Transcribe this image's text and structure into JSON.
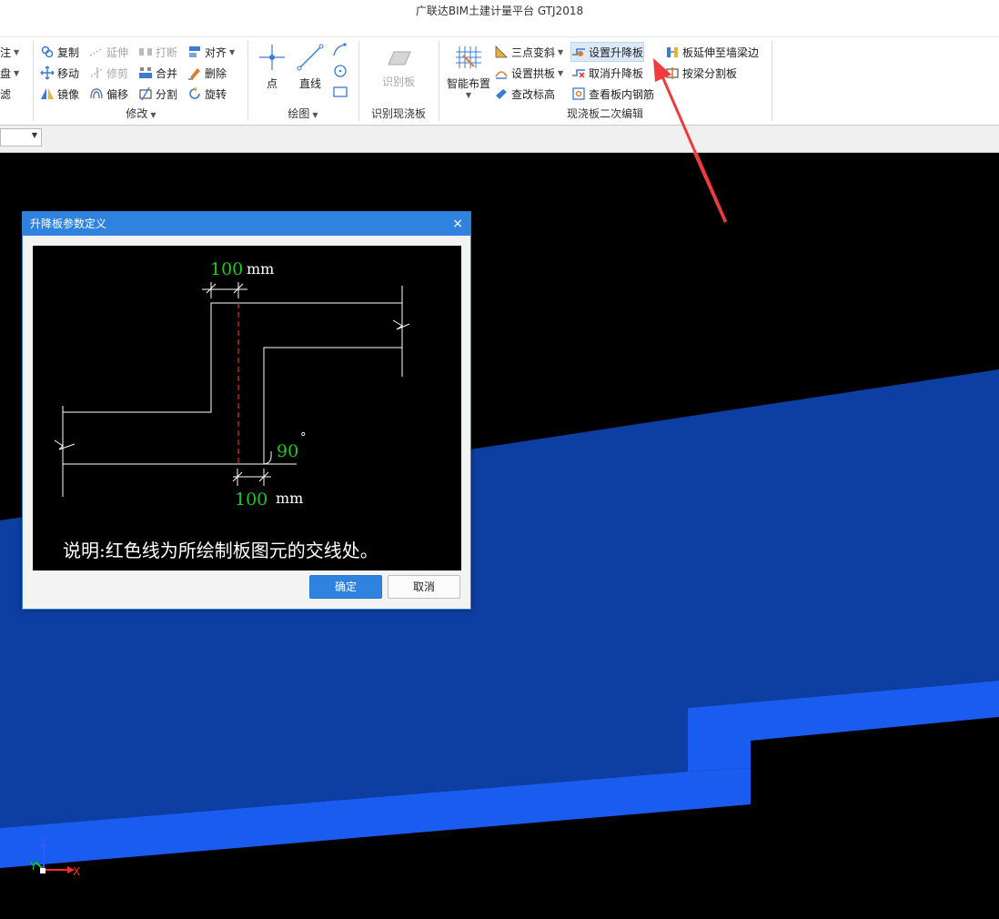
{
  "window": {
    "title": "广联达BIM土建计量平台 GTJ2018"
  },
  "ribbon": {
    "left_partial": [
      "注",
      "盘",
      "滤"
    ],
    "modify": {
      "label": "修改",
      "items": {
        "copy": "复制",
        "extend": "延伸",
        "break": "打断",
        "align": "对齐",
        "move": "移动",
        "trim": "修剪",
        "merge": "合并",
        "delete": "删除",
        "mirror": "镜像",
        "offset": "偏移",
        "split": "分割",
        "rotate": "旋转"
      }
    },
    "draw": {
      "label": "绘图",
      "point": "点",
      "line": "直线"
    },
    "recognize": {
      "label": "识别现浇板",
      "recognize_slab": "识别板"
    },
    "smart": {
      "label": "智能布置"
    },
    "slab_edit": {
      "label": "现浇板二次编辑",
      "three_point_slope": "三点变斜",
      "set_arch": "设置拱板",
      "check_elevation": "查改标高",
      "set_lift": "设置升降板",
      "cancel_lift": "取消升降板",
      "view_rebar": "查看板内钢筋",
      "extend_to_wall": "板延伸至墙梁边",
      "split_by_beam": "按梁分割板"
    }
  },
  "axes": {
    "z": "Z",
    "y": "Y",
    "x": "X"
  },
  "dialog": {
    "title": "升降板参数定义",
    "close": "×",
    "top_value": "100",
    "top_unit": "mm",
    "angle_value": "90",
    "angle_unit": "°",
    "bottom_value": "100",
    "bottom_unit": "mm",
    "note": "说明:红色线为所绘制板图元的交线处。",
    "ok": "确定",
    "cancel": "取消"
  },
  "colors": {
    "accent": "#2f83df",
    "slab_top": "#0d3fa2",
    "slab_edge": "#1a5cf0",
    "dim_green": "#1ec81e",
    "arrow": "#ef3b3b"
  }
}
